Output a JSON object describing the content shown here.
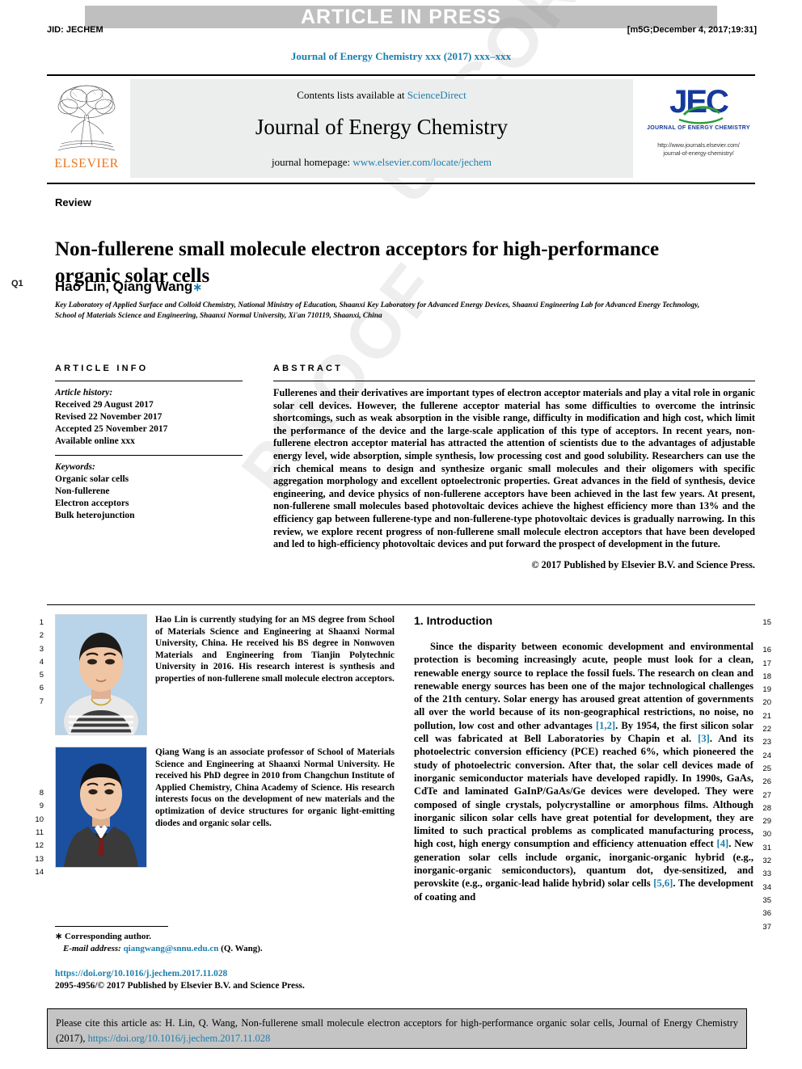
{
  "header": {
    "press_banner": "ARTICLE IN PRESS",
    "jid": "JID: JECHEM",
    "build_stamp": "[m5G;December 4, 2017;19:31]",
    "journal_ref": "Journal of Energy Chemistry xxx (2017) xxx–xxx"
  },
  "masthead": {
    "publisher_name": "ELSEVIER",
    "contents_prefix": "Contents lists available at ",
    "contents_link": "ScienceDirect",
    "journal_title": "Journal of Energy Chemistry",
    "homepage_prefix": "journal homepage: ",
    "homepage_link": "www.elsevier.com/locate/jechem",
    "jec_mark": "JEC",
    "jec_sub": "JOURNAL OF ENERGY CHEMISTRY",
    "jec_url_line1": "http://www.journals.elsevier.com/",
    "jec_url_line2": "journal-of-energy-chemistry/"
  },
  "title_block": {
    "doctype": "Review",
    "title": "Non-fullerene small molecule electron acceptors for high-performance organic solar cells",
    "authors": "Hao Lin, Qiang Wang",
    "corresponding_marker": "∗",
    "query_marker": "Q1",
    "affiliation": "Key Laboratory of Applied Surface and Colloid Chemistry, National Ministry of Education, Shaanxi Key Laboratory for Advanced Energy Devices, Shaanxi Engineering Lab for Advanced Energy Technology, School of Materials Science and Engineering, Shaanxi Normal University, Xi'an 710119, Shaanxi, China"
  },
  "article_info": {
    "heading": "ARTICLE INFO",
    "history_label": "Article history:",
    "history": [
      "Received 29 August 2017",
      "Revised 22 November 2017",
      "Accepted 25 November 2017",
      "Available online xxx"
    ],
    "keywords_label": "Keywords:",
    "keywords": [
      "Organic solar cells",
      "Non-fullerene",
      "Electron acceptors",
      "Bulk heterojunction"
    ]
  },
  "abstract": {
    "heading": "ABSTRACT",
    "body": "Fullerenes and their derivatives are important types of electron acceptor materials and play a vital role in organic solar cell devices. However, the fullerene acceptor material has some difficulties to overcome the intrinsic shortcomings, such as weak absorption in the visible range, difficulty in modification and high cost, which limit the performance of the device and the large-scale application of this type of acceptors. In recent years, non-fullerene electron acceptor material has attracted the attention of scientists due to the advantages of adjustable energy level, wide absorption, simple synthesis, low processing cost and good solubility. Researchers can use the rich chemical means to design and synthesize organic small molecules and their oligomers with specific aggregation morphology and excellent optoelectronic properties. Great advances in the field of synthesis, device engineering, and device physics of non-fullerene acceptors have been achieved in the last few years. At present, non-fullerene small molecules based photovoltaic devices achieve the highest efficiency more than 13% and the efficiency gap between fullerene-type and non-fullerene-type photovoltaic devices is gradually narrowing. In this review, we explore recent progress of non-fullerene small molecule electron acceptors that have been developed and led to high-efficiency photovoltaic devices and put forward the prospect of development in the future.",
    "copyright": "© 2017 Published by Elsevier B.V. and Science Press."
  },
  "biographies": [
    {
      "name": "Hao Lin",
      "text": " is currently studying for an MS degree from School of Materials Science and Engineering at Shaanxi Normal University, China. He received his BS degree in Nonwoven Materials and Engineering from Tianjin Polytechnic University in 2016. His research interest is synthesis and properties of non-fullerene small molecule electron acceptors."
    },
    {
      "name": "Qiang Wang",
      "text": " is an associate professor of School of Materials Science and Engineering at Shaanxi Normal University. He received his PhD degree in 2010 from Changchun Institute of Applied Chemistry, China Academy of Science. His research interests focus on the development of new materials and the optimization of device structures for organic light-emitting diodes and organic solar cells."
    }
  ],
  "introduction": {
    "heading": "1. Introduction",
    "paragraph_parts": [
      "Since the disparity between economic development and environmental protection is becoming increasingly acute, people must look for a clean, renewable energy source to replace the fossil fuels. The research on clean and renewable energy sources has been one of the major technological challenges of the 21th century. Solar energy has aroused great attention of governments all over the world because of its non-geographical restrictions, no noise, no pollution, low cost and other advantages ",
      "[1,2]",
      ". By 1954, the first silicon solar cell was fabricated at Bell Laboratories by Chapin et al. ",
      "[3]",
      ". And its photoelectric conversion efficiency (PCE) reached 6%, which pioneered the study of photoelectric conversion. After that, the solar cell devices made of inorganic semiconductor materials have developed rapidly. In 1990s, GaAs, CdTe and laminated GaInP/GaAs/Ge devices were developed. They were composed of single crystals, polycrystalline or amorphous films. Although inorganic silicon solar cells have great potential for development, they are limited to such practical problems as complicated manufacturing process, high cost, high energy consumption and efficiency attenuation effect ",
      "[4]",
      ". New generation solar cells include organic, inorganic-organic hybrid (e.g., inorganic-organic semiconductors), quantum dot, dye-sensitized, and perovskite (e.g., organic-lead halide hybrid) solar cells ",
      "[5,6]",
      ". The development of coating and"
    ]
  },
  "line_numbers": {
    "left": [
      "1",
      "2",
      "3",
      "4",
      "5",
      "6",
      "7",
      "8",
      "9",
      "10",
      "11",
      "12",
      "13",
      "14"
    ],
    "right": [
      "15",
      "16",
      "17",
      "18",
      "19",
      "20",
      "21",
      "22",
      "23",
      "24",
      "25",
      "26",
      "27",
      "28",
      "29",
      "30",
      "31",
      "32",
      "33",
      "34",
      "35",
      "36",
      "37"
    ]
  },
  "footnote": {
    "corresponding_marker": "∗",
    "corresponding_label": " Corresponding author.",
    "email_label": "E-mail address:",
    "email": "qiangwang@snnu.edu.cn",
    "email_suffix": " (Q. Wang).",
    "doi_url": "https://doi.org/10.1016/j.jechem.2017.11.028",
    "issn_line": "2095-4956/© 2017 Published by Elsevier B.V. and Science Press."
  },
  "citation_box": {
    "text_before": "Please cite this article as: H. Lin, Q. Wang, Non-fullerene small molecule electron acceptors for high-performance organic solar cells, Journal of Energy Chemistry (2017), ",
    "link": "https://doi.org/10.1016/j.jechem.2017.11.028"
  },
  "watermark": {
    "line1": "UNCORRECTED",
    "line2": "PROOF"
  },
  "colors": {
    "link": "#1a7fad",
    "banner_gray": "#bfbfbf",
    "masthead_gray": "#eceded",
    "cite_gray": "#c4c4c4",
    "elsevier_orange": "#E87722",
    "jec_blue": "#16399c"
  }
}
